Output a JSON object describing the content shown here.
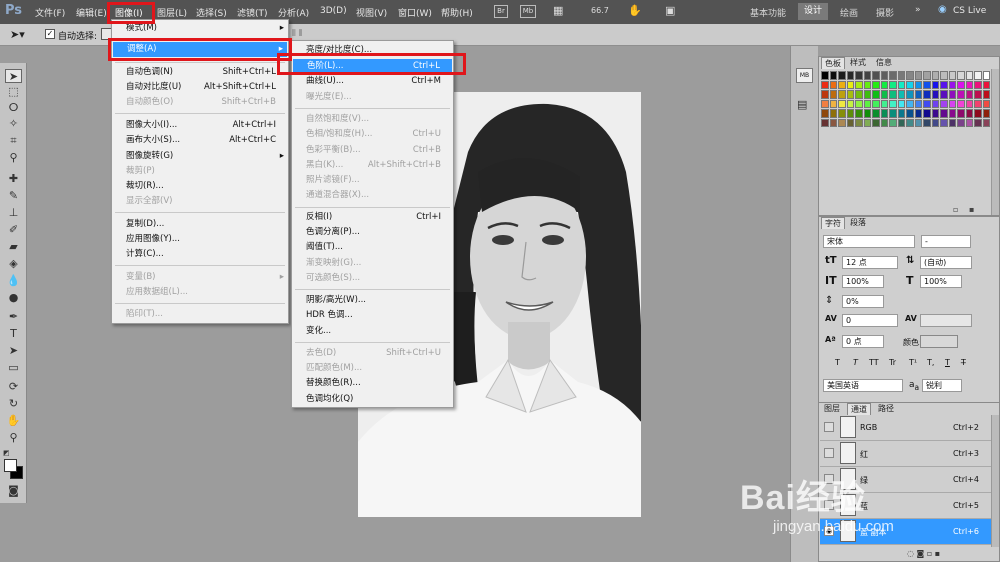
{
  "app": {
    "logo": "Ps"
  },
  "menubar": {
    "items": [
      "文件(F)",
      "编辑(E)",
      "图像(I)",
      "图层(L)",
      "选择(S)",
      "滤镜(T)",
      "分析(A)",
      "3D(D)",
      "视图(V)",
      "窗口(W)",
      "帮助(H)"
    ],
    "br_label": "Br",
    "mb_label": "Mb",
    "zoom": "66.7",
    "workspaces": [
      "基本功能",
      "设计",
      "绘画",
      "摄影"
    ],
    "cslive": "CS Live"
  },
  "options": {
    "auto_select": "自动选择:"
  },
  "image_menu": {
    "items": [
      {
        "label": "模式(M)",
        "shortcut": "",
        "disabled": false,
        "sub": true
      },
      {
        "label": "调整(A)",
        "shortcut": "",
        "disabled": false,
        "sub": true,
        "hl": true
      },
      {
        "label": "自动色调(N)",
        "shortcut": "Shift+Ctrl+L",
        "disabled": false
      },
      {
        "label": "自动对比度(U)",
        "shortcut": "Alt+Shift+Ctrl+L",
        "disabled": false
      },
      {
        "label": "自动颜色(O)",
        "shortcut": "Shift+Ctrl+B",
        "disabled": true
      },
      {
        "label": "图像大小(I)...",
        "shortcut": "Alt+Ctrl+I",
        "disabled": false
      },
      {
        "label": "画布大小(S)...",
        "shortcut": "Alt+Ctrl+C",
        "disabled": false
      },
      {
        "label": "图像旋转(G)",
        "shortcut": "",
        "disabled": false,
        "sub": true
      },
      {
        "label": "裁剪(P)",
        "shortcut": "",
        "disabled": true
      },
      {
        "label": "裁切(R)...",
        "shortcut": "",
        "disabled": false
      },
      {
        "label": "显示全部(V)",
        "shortcut": "",
        "disabled": true
      },
      {
        "label": "复制(D)...",
        "shortcut": "",
        "disabled": false
      },
      {
        "label": "应用图像(Y)...",
        "shortcut": "",
        "disabled": false
      },
      {
        "label": "计算(C)...",
        "shortcut": "",
        "disabled": false
      },
      {
        "label": "变量(B)",
        "shortcut": "",
        "disabled": true,
        "sub": true
      },
      {
        "label": "应用数据组(L)...",
        "shortcut": "",
        "disabled": true
      },
      {
        "label": "陷印(T)...",
        "shortcut": "",
        "disabled": true
      }
    ]
  },
  "adjust_menu": {
    "items": [
      {
        "label": "亮度/对比度(C)...",
        "shortcut": "",
        "disabled": false
      },
      {
        "label": "色阶(L)...",
        "shortcut": "Ctrl+L",
        "disabled": false,
        "hl": true
      },
      {
        "label": "曲线(U)...",
        "shortcut": "Ctrl+M",
        "disabled": false
      },
      {
        "label": "曝光度(E)...",
        "shortcut": "",
        "disabled": true
      },
      {
        "label": "自然饱和度(V)...",
        "shortcut": "",
        "disabled": true
      },
      {
        "label": "色相/饱和度(H)...",
        "shortcut": "Ctrl+U",
        "disabled": true
      },
      {
        "label": "色彩平衡(B)...",
        "shortcut": "Ctrl+B",
        "disabled": true
      },
      {
        "label": "黑白(K)...",
        "shortcut": "Alt+Shift+Ctrl+B",
        "disabled": true
      },
      {
        "label": "照片滤镜(F)...",
        "shortcut": "",
        "disabled": true
      },
      {
        "label": "通道混合器(X)...",
        "shortcut": "",
        "disabled": true
      },
      {
        "label": "反相(I)",
        "shortcut": "Ctrl+I",
        "disabled": false
      },
      {
        "label": "色调分离(P)...",
        "shortcut": "",
        "disabled": false
      },
      {
        "label": "阈值(T)...",
        "shortcut": "",
        "disabled": false
      },
      {
        "label": "渐变映射(G)...",
        "shortcut": "",
        "disabled": true
      },
      {
        "label": "可选颜色(S)...",
        "shortcut": "",
        "disabled": true
      },
      {
        "label": "阴影/高光(W)...",
        "shortcut": "",
        "disabled": false
      },
      {
        "label": "HDR 色调...",
        "shortcut": "",
        "disabled": false
      },
      {
        "label": "变化...",
        "shortcut": "",
        "disabled": false
      },
      {
        "label": "去色(D)",
        "shortcut": "Shift+Ctrl+U",
        "disabled": true
      },
      {
        "label": "匹配颜色(M)...",
        "shortcut": "",
        "disabled": true
      },
      {
        "label": "替换颜色(R)...",
        "shortcut": "",
        "disabled": false
      },
      {
        "label": "色调均化(Q)",
        "shortcut": "",
        "disabled": false
      }
    ]
  },
  "color_panel": {
    "tabs": [
      "色板",
      "样式",
      "信息"
    ]
  },
  "char_panel": {
    "tabs": [
      "字符",
      "段落"
    ],
    "font": "宋体",
    "style": "-",
    "size": "12 点",
    "leading": "(自动)",
    "vscale": "100%",
    "hscale": "100%",
    "baseline_shift": "0%",
    "tracking": "0",
    "kerning": "0 点",
    "color_label": "颜色:",
    "text_styles": [
      "T",
      "T",
      "TT",
      "Tr",
      "T¹",
      "T,",
      "T",
      "T̶"
    ],
    "language": "美国英语",
    "aa_prefix": "a",
    "aa_suffix": "a",
    "antialias": "锐利"
  },
  "channels_panel": {
    "tabs": [
      "图层",
      "通道",
      "路径"
    ],
    "rows": [
      {
        "name": "RGB",
        "shortcut": "Ctrl+2"
      },
      {
        "name": "红",
        "shortcut": "Ctrl+3"
      },
      {
        "name": "绿",
        "shortcut": "Ctrl+4"
      },
      {
        "name": "蓝",
        "shortcut": "Ctrl+5"
      },
      {
        "name": "蓝 副本",
        "shortcut": "Ctrl+6"
      }
    ]
  },
  "watermark": {
    "text": "Bai经验",
    "url": "jingyan.baidu.com"
  },
  "colors": {
    "menubar": "#535353",
    "highlight": "#3399ff",
    "annotation": "#e0161b"
  }
}
